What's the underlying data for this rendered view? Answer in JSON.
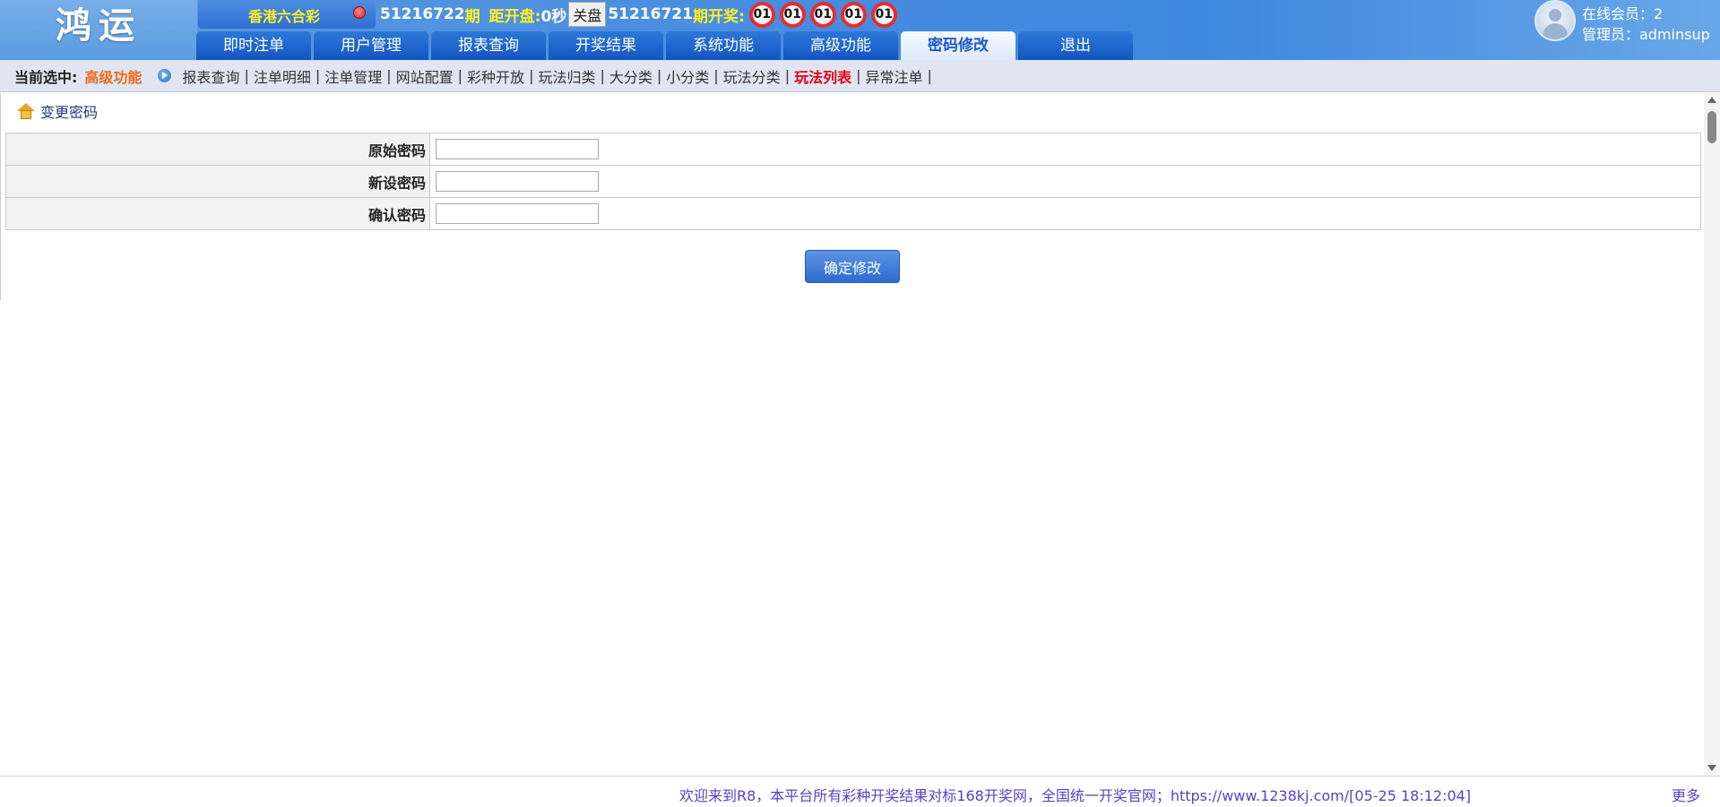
{
  "header": {
    "logo_text": "鸿运",
    "lottery_name": "香港六合彩",
    "ticker": {
      "current_issue": "51216722",
      "issue_suffix": "期",
      "countdown_label": "距开盘:",
      "countdown_value": "0秒",
      "status_tag": "关盘",
      "last_issue": "51216721",
      "draw_label": "期开奖:",
      "balls": [
        "01",
        "01",
        "01",
        "01",
        "01"
      ]
    },
    "nav_tabs": [
      "即时注单",
      "用户管理",
      "报表查询",
      "开奖结果",
      "系统功能",
      "高级功能",
      "密码修改",
      "退出"
    ],
    "active_tab": "密码修改",
    "online_members": "在线会员：2",
    "admin": "管理员：adminsup"
  },
  "breadcrumb": {
    "current_label": "当前选中:",
    "current_value": "高级功能",
    "links": [
      "报表查询",
      "注单明细",
      "注单管理",
      "网站配置",
      "彩种开放",
      "玩法归类",
      "大分类",
      "小分类",
      "玩法分类",
      "玩法列表",
      "异常注单"
    ],
    "highlighted": "玩法列表"
  },
  "page": {
    "title": "变更密码",
    "fields": [
      {
        "label": "原始密码",
        "value": ""
      },
      {
        "label": "新设密码",
        "value": ""
      },
      {
        "label": "确认密码",
        "value": ""
      }
    ],
    "submit_label": "确定修改"
  },
  "footer": {
    "notice": "欢迎来到R8，本平台所有彩种开奖结果对标168开奖网，全国统一开奖官网；https://www.1238kj.com/[05-25 18:12:04]",
    "more": "更多"
  },
  "colors": {
    "header_blue": "#3f86de",
    "tab_blue": "#1356c2",
    "highlight_orange": "#f06a1a",
    "highlight_red": "#e60012",
    "ticker_yellow": "#ffef2a",
    "footer_purple": "#5a3fc8"
  }
}
